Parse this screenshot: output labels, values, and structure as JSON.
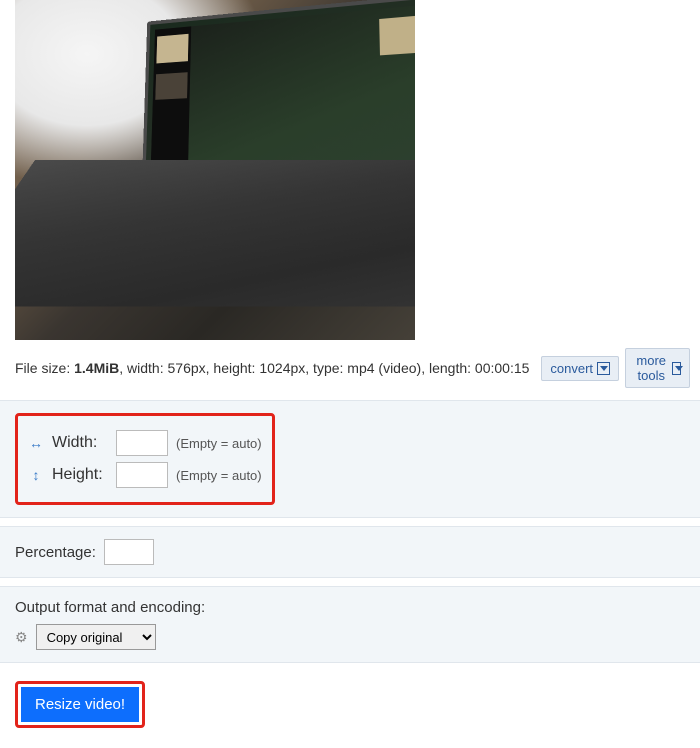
{
  "fileinfo": {
    "prefix": "File size: ",
    "size": "1.4MiB",
    "rest": ", width: 576px, height: 1024px, type: mp4 (video), length: 00:00:15"
  },
  "tools": {
    "convert": "convert",
    "more": "more tools"
  },
  "dimensions": {
    "width_label": "Width:",
    "height_label": "Height:",
    "hint": "(Empty = auto)"
  },
  "percentage": {
    "label": "Percentage:"
  },
  "format": {
    "label": "Output format and encoding:",
    "selected": "Copy original"
  },
  "submit": {
    "label": "Resize video!"
  }
}
